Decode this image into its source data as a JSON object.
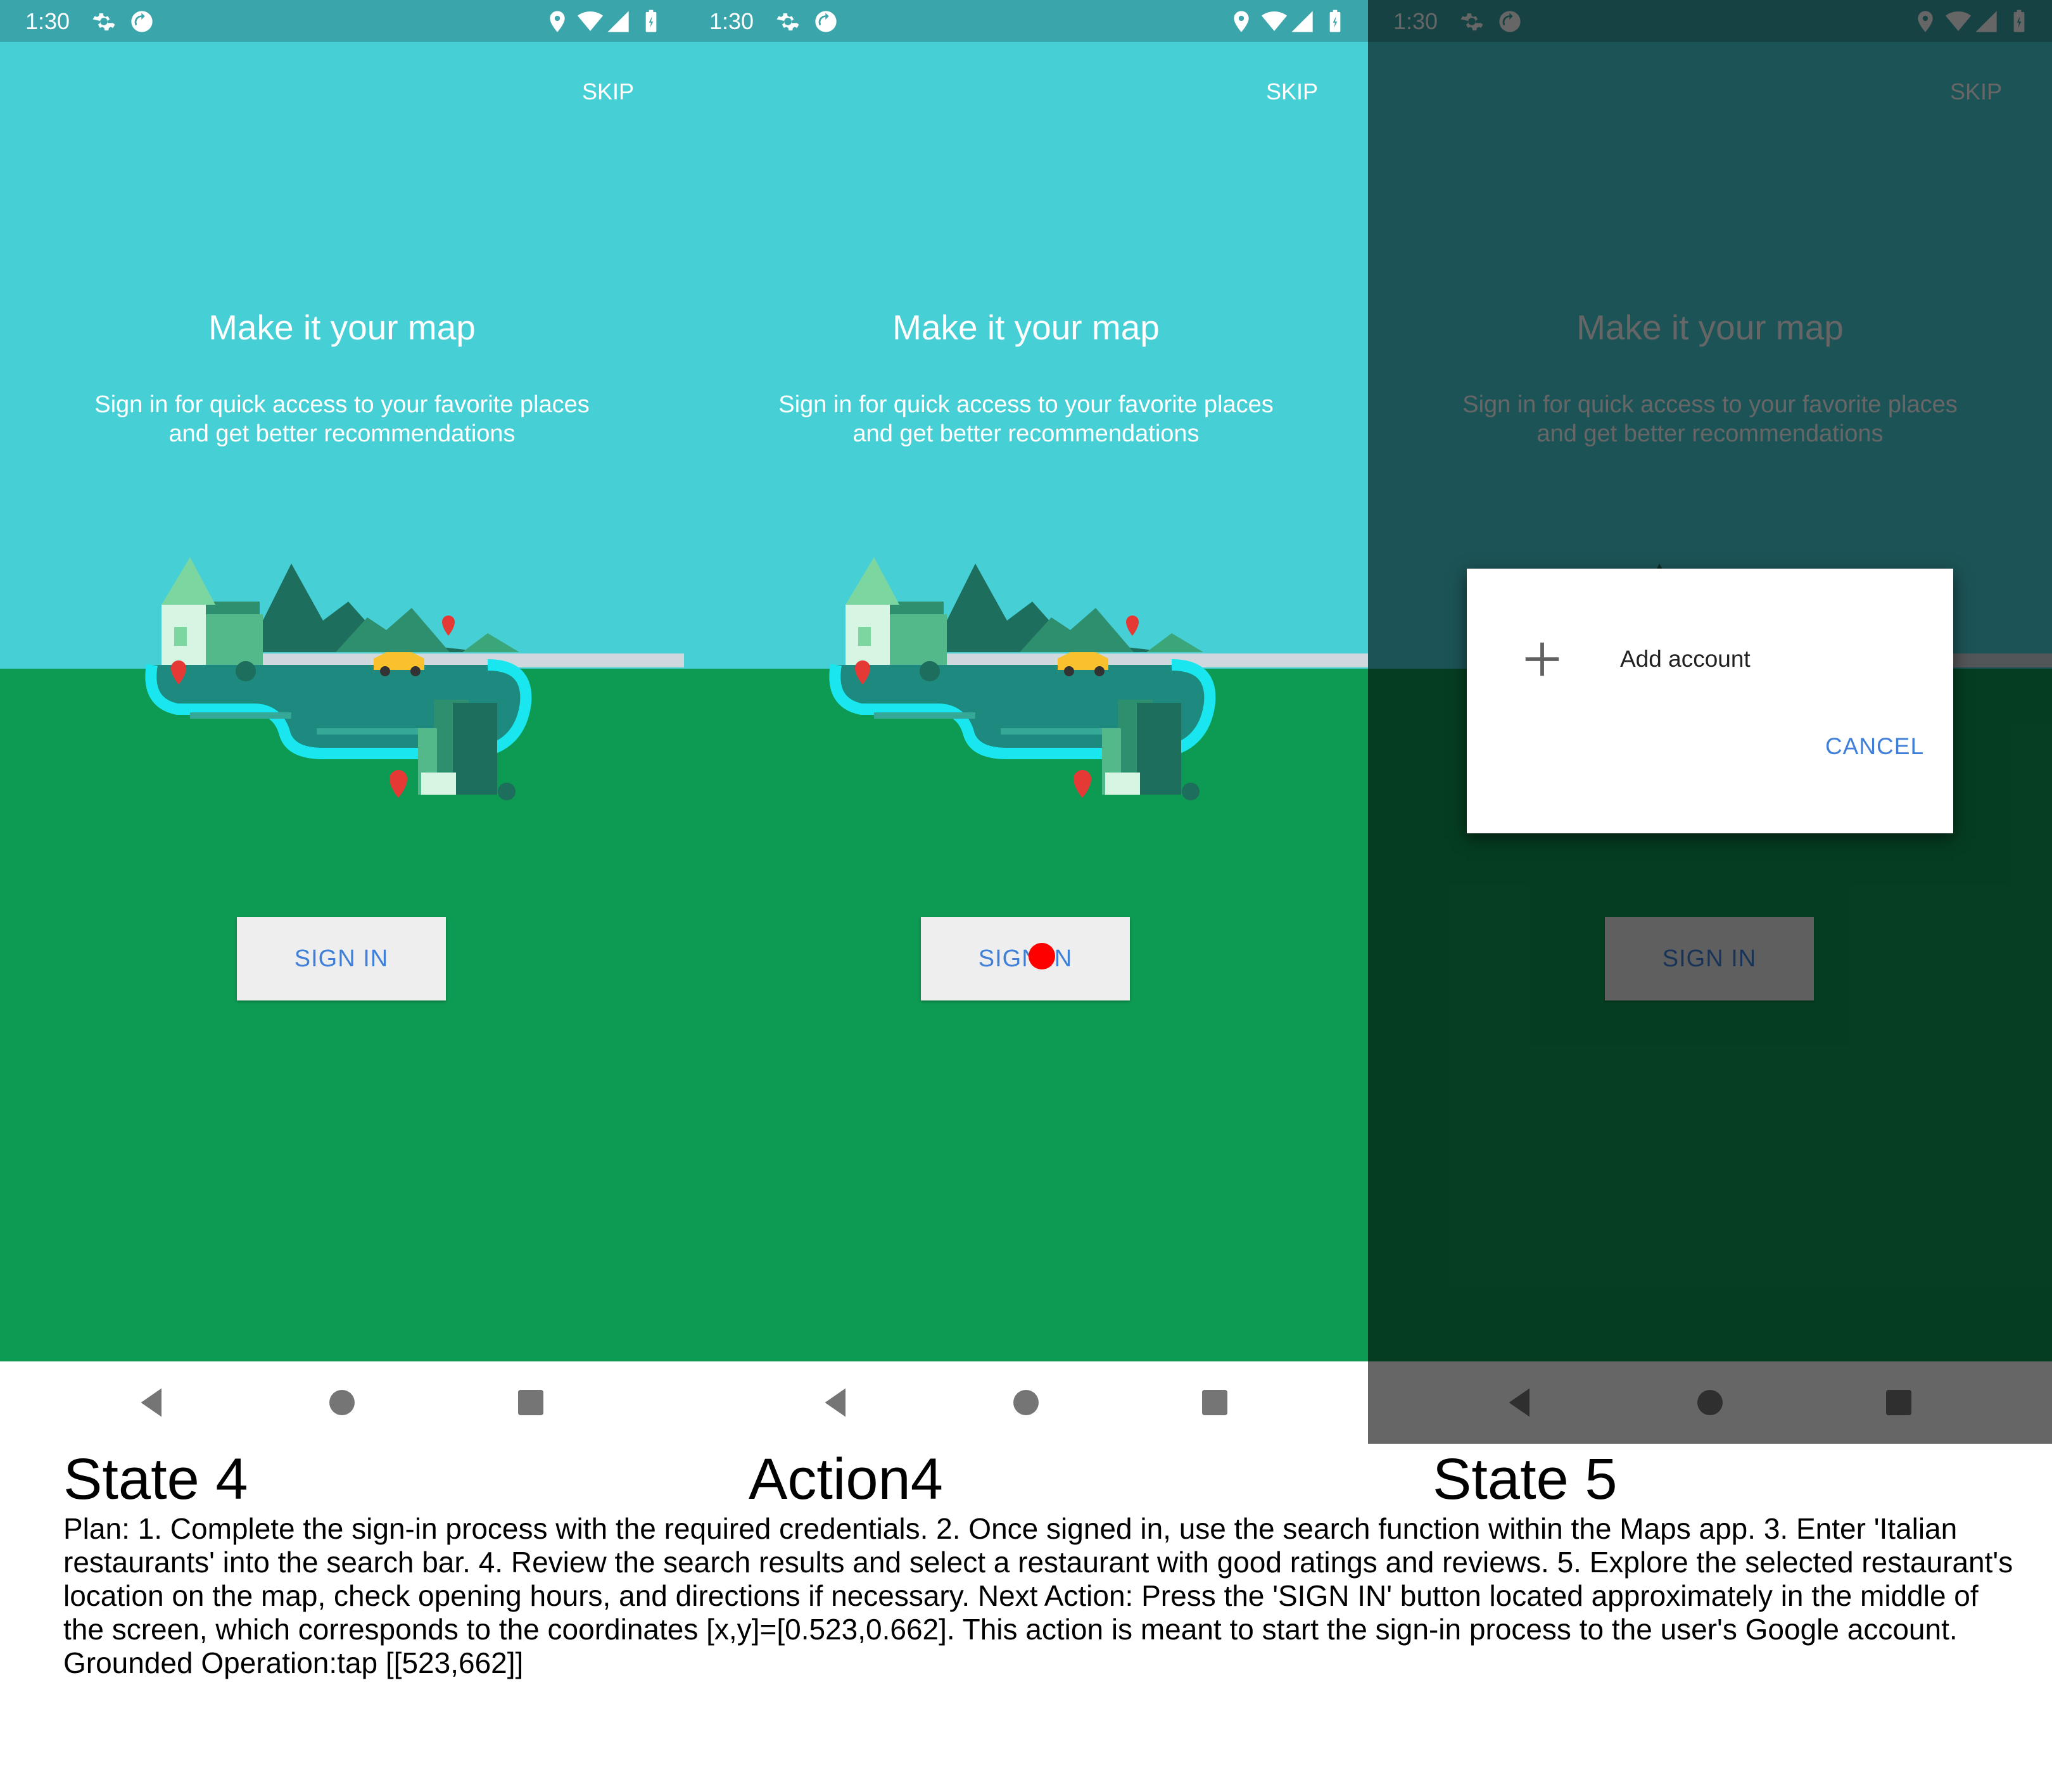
{
  "colors": {
    "sky": "#47cfd6",
    "status_bar": "#3aa5ab",
    "ground": "#0d9a52",
    "accent_blue": "#3f7fd8",
    "tap_marker": "#ff0000"
  },
  "status_bar": {
    "time": "1:30",
    "icons": [
      "settings-icon",
      "sync-icon",
      "location-icon",
      "wifi-icon",
      "cell-signal-icon",
      "battery-icon"
    ]
  },
  "screen": {
    "skip_label": "SKIP",
    "headline": "Make it your map",
    "subtext_line1": "Sign in for quick access to your favorite places",
    "subtext_line2": "and get better recommendations",
    "signin_label": "SIGN IN"
  },
  "nav_bar": {
    "icons": [
      "back-icon",
      "home-icon",
      "recents-icon"
    ]
  },
  "dialog": {
    "add_account_label": "Add account",
    "cancel_label": "CANCEL"
  },
  "captions": {
    "state4": "State 4",
    "action4": "Action4",
    "state5": "State 5"
  },
  "plan_text": "Plan: 1. Complete the sign-in process with the required credentials. 2. Once signed in, use the search function within the Maps app. 3. Enter 'Italian restaurants' into the search bar. 4. Review the search results and select a restaurant with good ratings and reviews. 5. Explore the selected restaurant's location on the map, check opening hours, and directions if necessary. Next Action: Press the 'SIGN IN' button located approximately in the middle of the screen, which corresponds to the coordinates [x,y]=[0.523,0.662]. This action is meant to start the sign-in process to the user's Google account. Grounded Operation:tap [[523,662]]"
}
